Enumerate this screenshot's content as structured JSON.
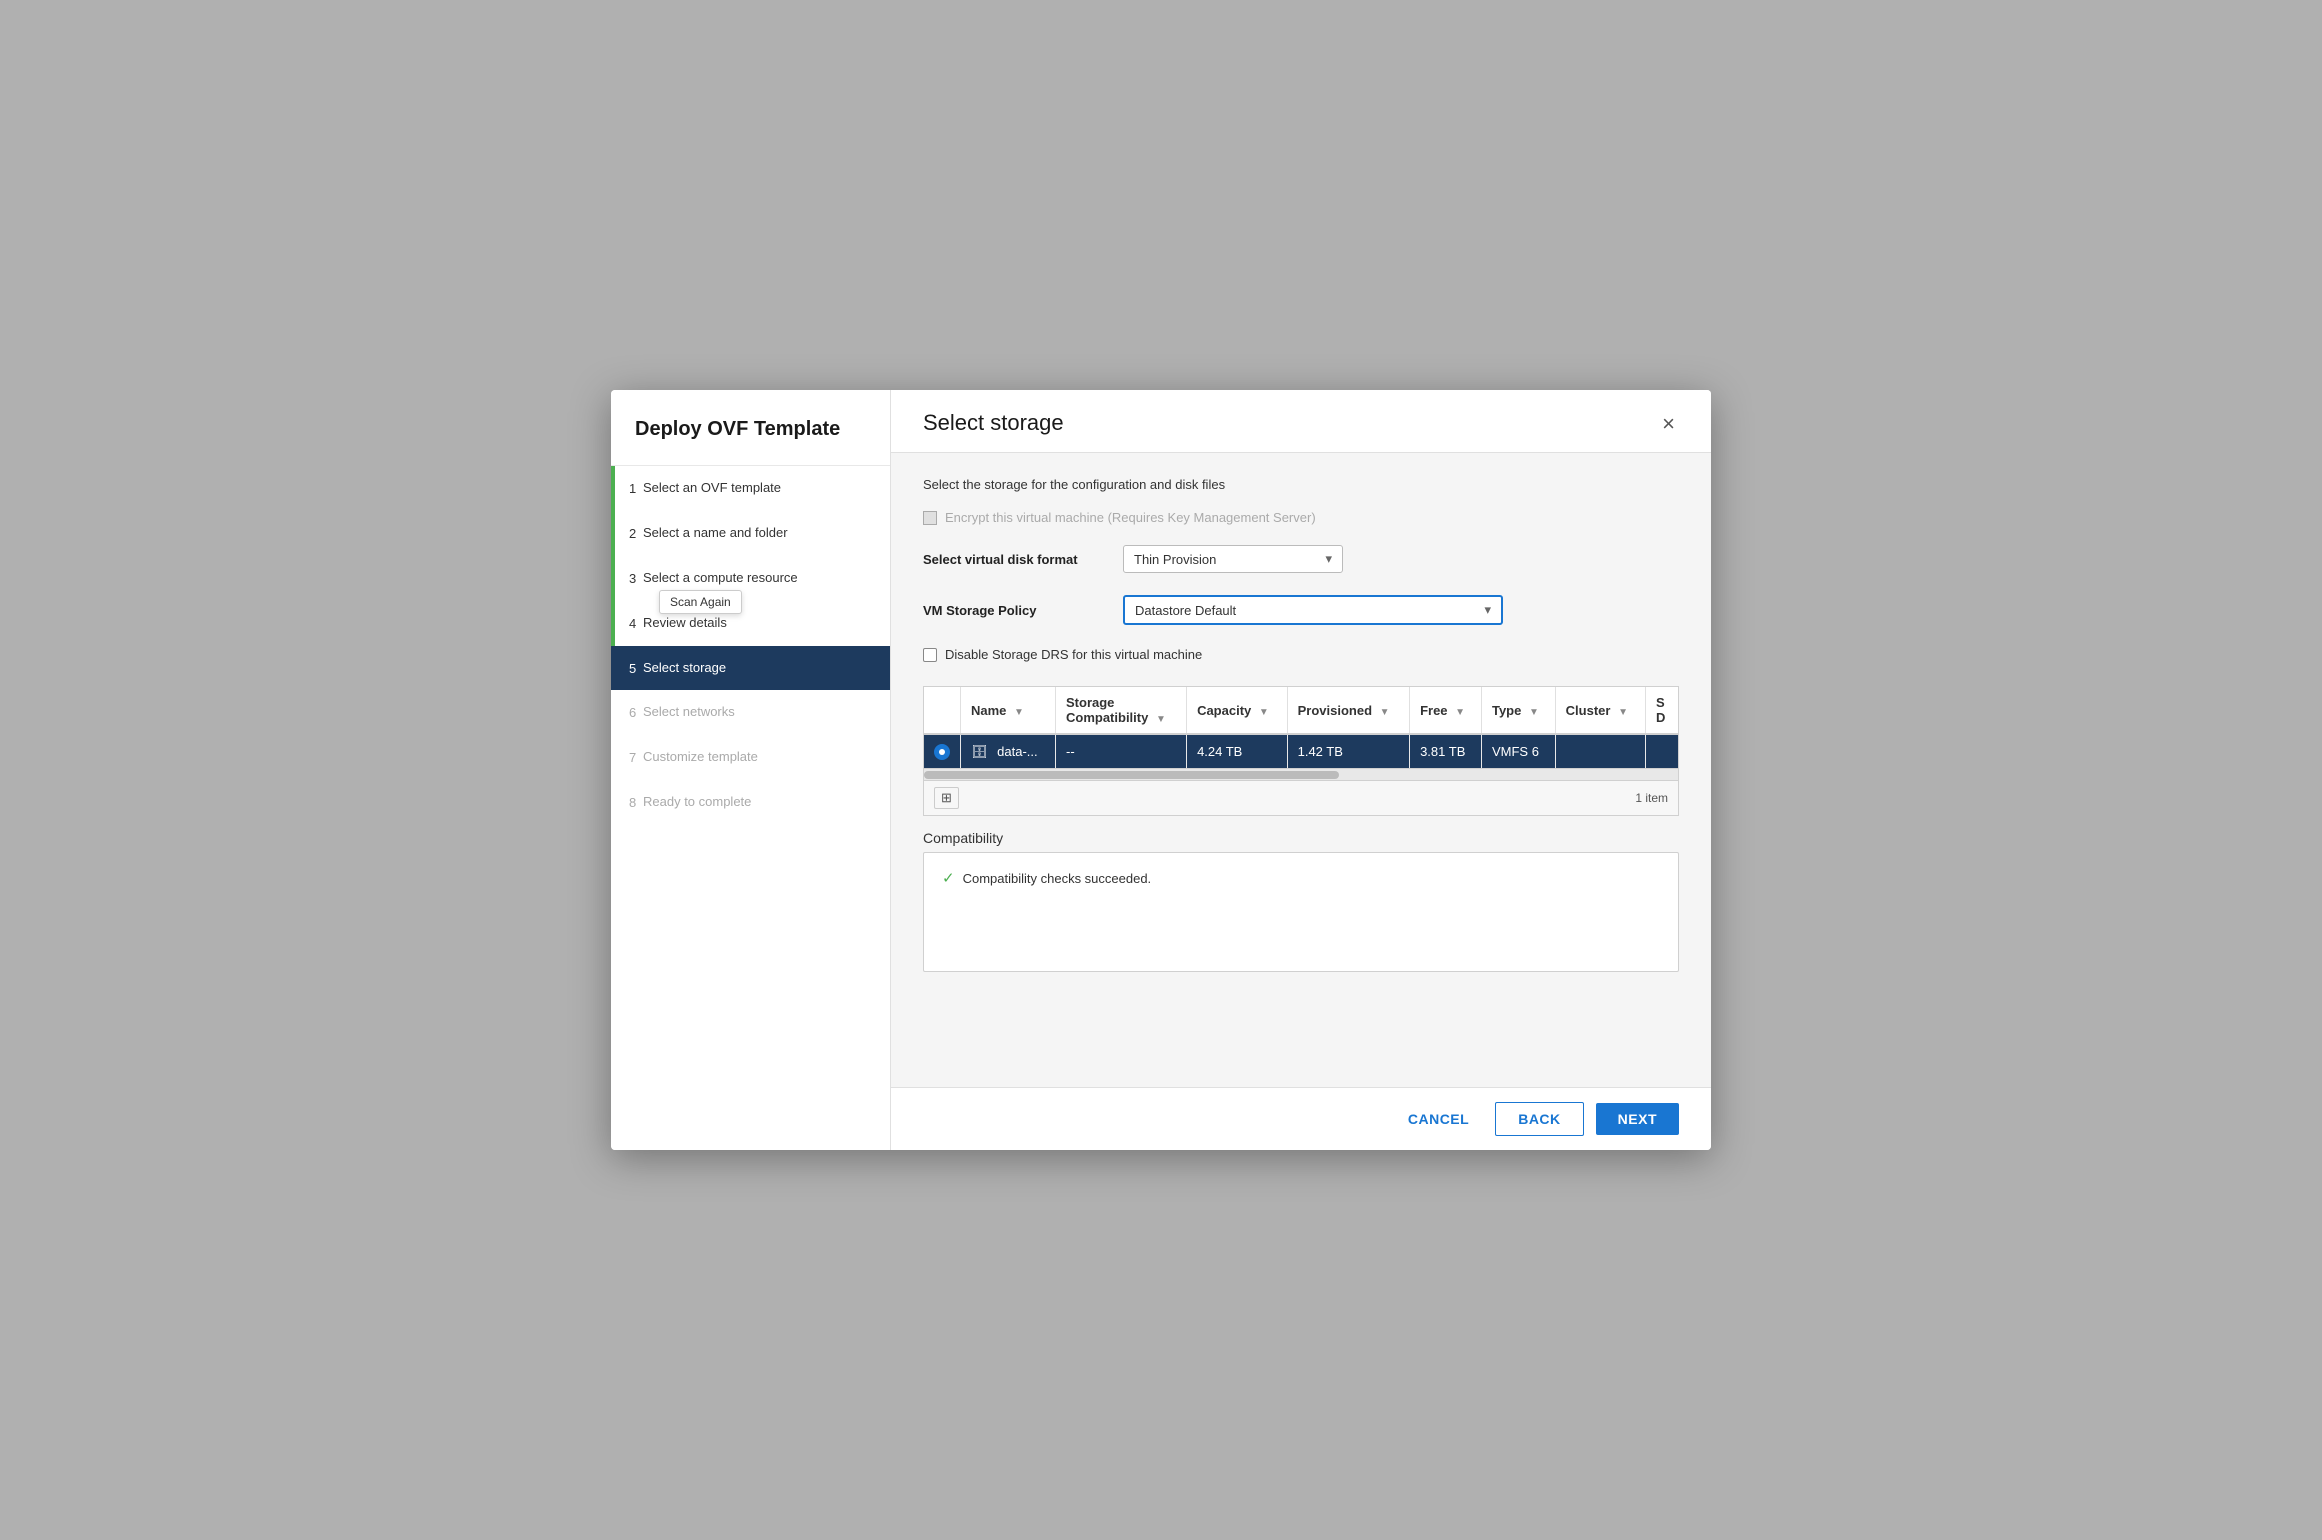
{
  "dialog": {
    "title": "Deploy OVF Template",
    "close_label": "×"
  },
  "sidebar": {
    "steps": [
      {
        "number": "1",
        "label": "Select an OVF template",
        "state": "completed"
      },
      {
        "number": "2",
        "label": "Select a name and folder",
        "state": "completed"
      },
      {
        "number": "3",
        "label": "Select a compute resource",
        "state": "completed",
        "tooltip": "Scan Again"
      },
      {
        "number": "4",
        "label": "Review details",
        "state": "completed"
      },
      {
        "number": "5",
        "label": "Select storage",
        "state": "active"
      },
      {
        "number": "6",
        "label": "Select networks",
        "state": "disabled"
      },
      {
        "number": "7",
        "label": "Customize template",
        "state": "disabled"
      },
      {
        "number": "8",
        "label": "Ready to complete",
        "state": "disabled"
      }
    ]
  },
  "main": {
    "title": "Select storage",
    "subtitle": "Select the storage for the configuration and disk files",
    "encrypt_label": "Encrypt this virtual machine (Requires Key Management Server)",
    "disk_format_label": "Select virtual disk format",
    "disk_format_value": "Thin Provision",
    "storage_policy_label": "VM Storage Policy",
    "storage_policy_value": "Datastore Default",
    "disable_drs_label": "Disable Storage DRS for this virtual machine",
    "table": {
      "columns": [
        {
          "key": "radio",
          "label": ""
        },
        {
          "key": "name",
          "label": "Name"
        },
        {
          "key": "storage_compat",
          "label": "Storage Compatibility"
        },
        {
          "key": "capacity",
          "label": "Capacity"
        },
        {
          "key": "provisioned",
          "label": "Provisioned"
        },
        {
          "key": "free",
          "label": "Free"
        },
        {
          "key": "type",
          "label": "Type"
        },
        {
          "key": "cluster",
          "label": "Cluster"
        },
        {
          "key": "sd",
          "label": "S D"
        }
      ],
      "rows": [
        {
          "selected": true,
          "name": "data-...",
          "storage_compat": "--",
          "capacity": "4.24 TB",
          "provisioned": "1.42 TB",
          "free": "3.81 TB",
          "type": "VMFS 6",
          "cluster": "",
          "sd": ""
        }
      ],
      "item_count": "1 item"
    },
    "compatibility": {
      "label": "Compatibility",
      "success_text": "Compatibility checks succeeded."
    },
    "buttons": {
      "cancel": "CANCEL",
      "back": "BACK",
      "next": "NEXT"
    }
  }
}
